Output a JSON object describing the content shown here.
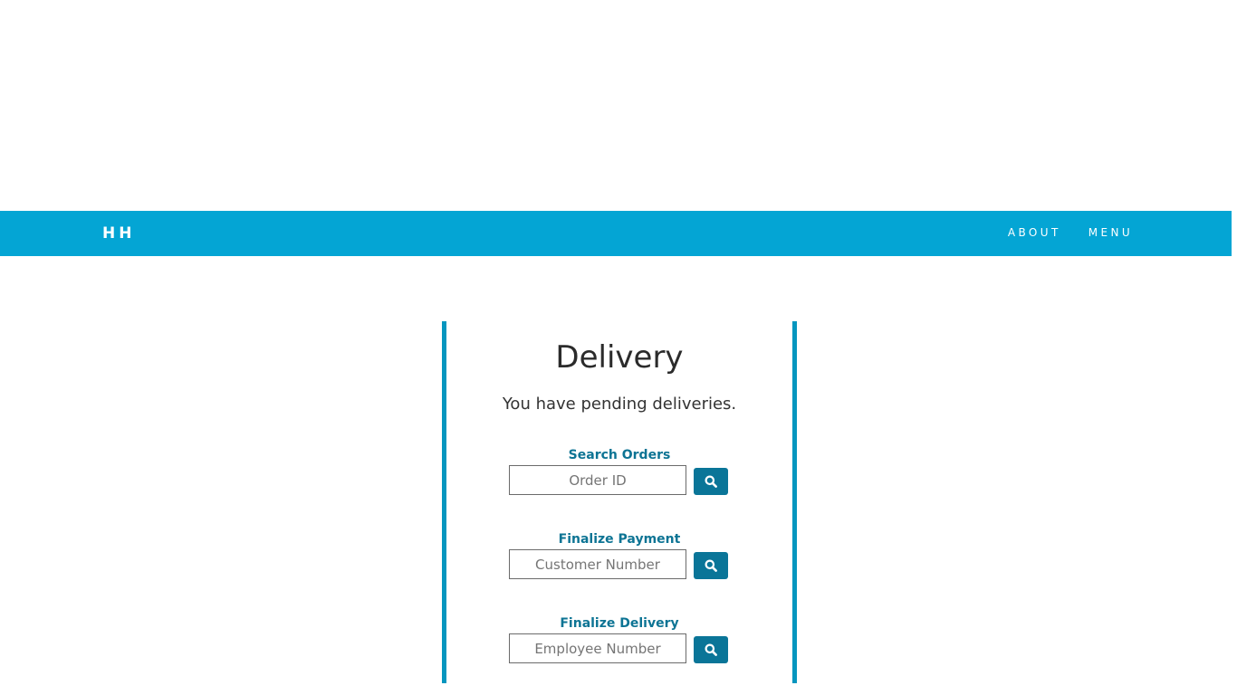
{
  "navbar": {
    "brand": "HH",
    "links": [
      {
        "label": "ABOUT"
      },
      {
        "label": "MENU"
      }
    ],
    "color": "#04a5d4"
  },
  "panel": {
    "title": "Delivery",
    "subtitle": "You have pending deliveries.",
    "border_color": "#0596bf",
    "sections": [
      {
        "label": "Search Orders",
        "placeholder": "Order ID",
        "button_icon": "search-icon"
      },
      {
        "label": "Finalize Payment",
        "placeholder": "Customer Number",
        "button_icon": "search-icon"
      },
      {
        "label": "Finalize Delivery",
        "placeholder": "Employee Number",
        "button_icon": "search-icon"
      }
    ]
  },
  "colors": {
    "accent": "#0a7598",
    "label": "#0d7494"
  }
}
